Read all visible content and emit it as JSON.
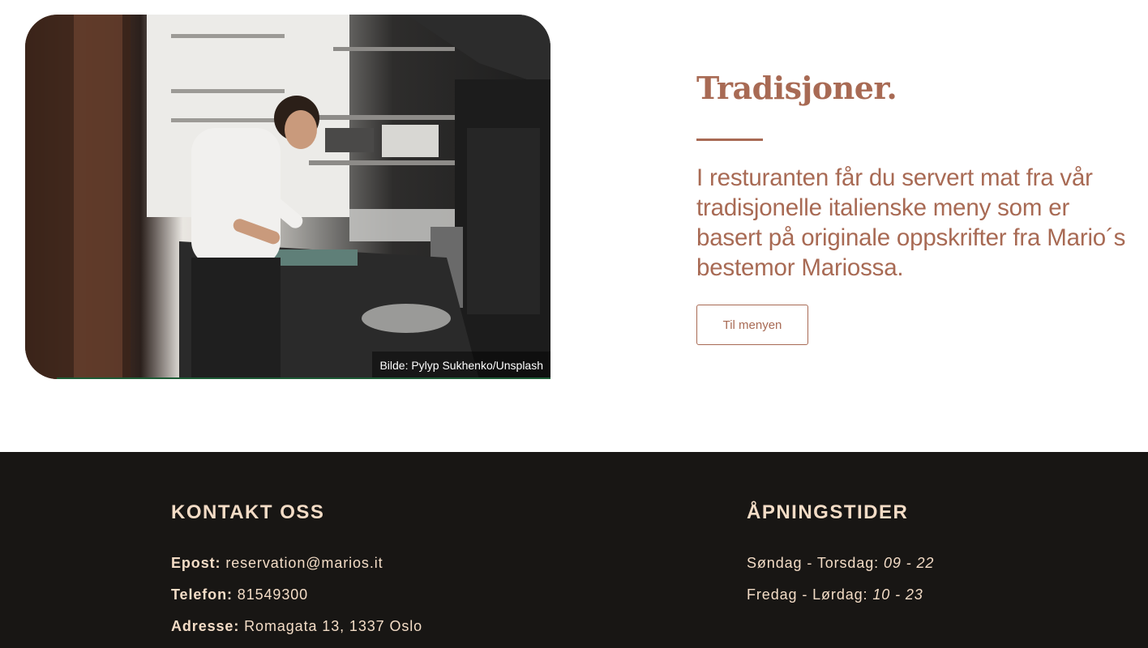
{
  "feature": {
    "photo_credit": "Bilde: Pylyp Sukhenko/Unsplash",
    "title": "Tradisjoner.",
    "body": "I resturanten får du servert mat fra vår tradisjonelle italienske meny som er basert på originale oppskrifter fra Mario´s bestemor Mariossa.",
    "button_label": "Til menyen"
  },
  "footer": {
    "contact": {
      "heading": "KONTAKT OSS",
      "email_label": "Epost:",
      "email_value": "reservation@marios.it",
      "phone_label": "Telefon:",
      "phone_value": "81549300",
      "address_label": "Adresse:",
      "address_value": "Romagata 13, 1337 Oslo"
    },
    "hours": {
      "heading": "ÅPNINGSTIDER",
      "weekday_label": "Søndag - Torsdag:",
      "weekday_value": "09 - 22",
      "weekend_label": "Fredag - Lørdag:",
      "weekend_value": "10 - 23"
    }
  },
  "colors": {
    "accent": "#a86a54",
    "footer_bg": "#181614",
    "footer_text": "#f3dcc6"
  }
}
